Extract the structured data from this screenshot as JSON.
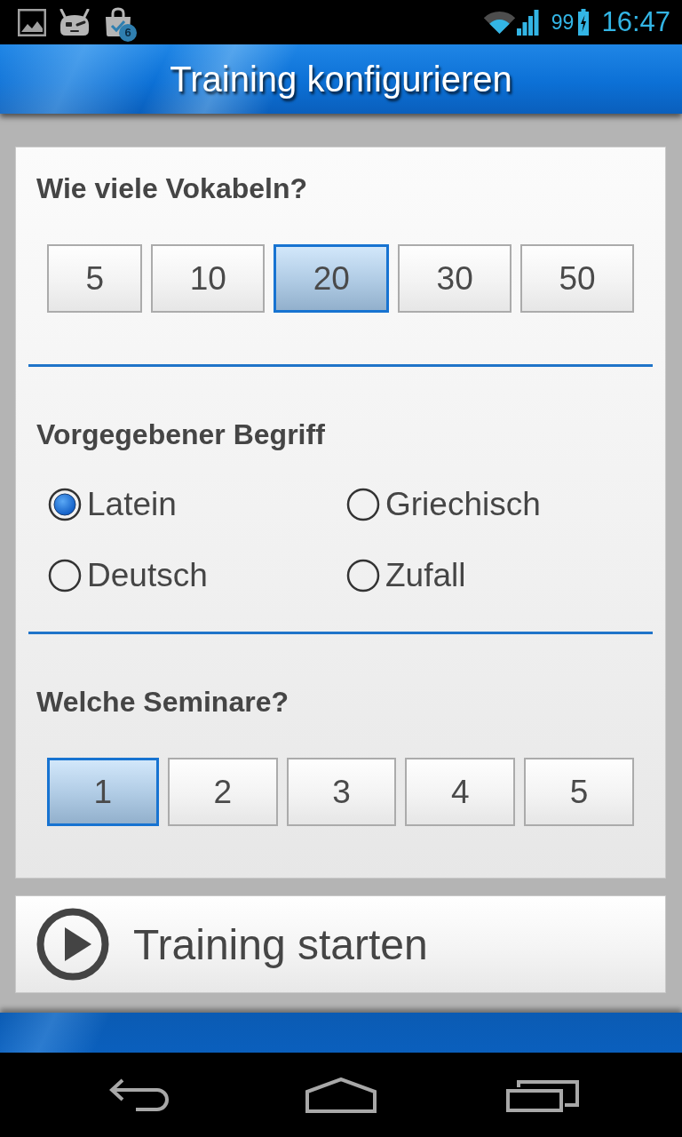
{
  "status_bar": {
    "notification_badge": "6",
    "battery": "99",
    "charging": true,
    "time": "16:47"
  },
  "title": "Training konfigurieren",
  "sections": [
    {
      "kind": "segmented",
      "heading": "Wie viele Vokabeln?",
      "options": [
        {
          "label": "5",
          "selected": false
        },
        {
          "label": "10",
          "selected": false
        },
        {
          "label": "20",
          "selected": true
        },
        {
          "label": "30",
          "selected": false
        },
        {
          "label": "50",
          "selected": false
        }
      ]
    },
    {
      "kind": "radio",
      "heading": "Vorgegebener Begriff",
      "options": [
        {
          "label": "Latein",
          "selected": true
        },
        {
          "label": "Griechisch",
          "selected": false
        },
        {
          "label": "Deutsch",
          "selected": false
        },
        {
          "label": "Zufall",
          "selected": false
        }
      ]
    },
    {
      "kind": "segmented",
      "heading": "Welche Seminare?",
      "options": [
        {
          "label": "1",
          "selected": true
        },
        {
          "label": "2",
          "selected": false
        },
        {
          "label": "3",
          "selected": false
        },
        {
          "label": "4",
          "selected": false
        },
        {
          "label": "5",
          "selected": false
        }
      ]
    }
  ],
  "start_button": {
    "label": "Training starten"
  }
}
